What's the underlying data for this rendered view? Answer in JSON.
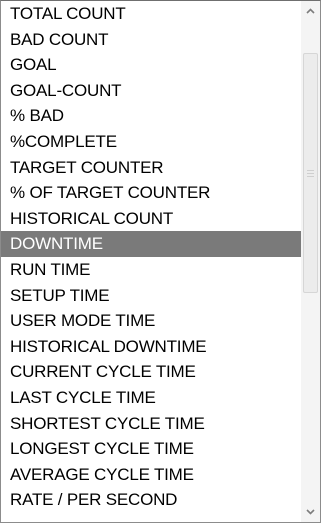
{
  "list": {
    "items": [
      {
        "label": "TOTAL COUNT",
        "selected": false
      },
      {
        "label": "BAD COUNT",
        "selected": false
      },
      {
        "label": "GOAL",
        "selected": false
      },
      {
        "label": "GOAL-COUNT",
        "selected": false
      },
      {
        "label": "% BAD",
        "selected": false
      },
      {
        "label": "%COMPLETE",
        "selected": false
      },
      {
        "label": "TARGET COUNTER",
        "selected": false
      },
      {
        "label": "% OF TARGET COUNTER",
        "selected": false
      },
      {
        "label": "HISTORICAL COUNT",
        "selected": false
      },
      {
        "label": "DOWNTIME",
        "selected": true
      },
      {
        "label": "RUN TIME",
        "selected": false
      },
      {
        "label": "SETUP TIME",
        "selected": false
      },
      {
        "label": "USER MODE TIME",
        "selected": false
      },
      {
        "label": "HISTORICAL DOWNTIME",
        "selected": false
      },
      {
        "label": "CURRENT CYCLE TIME",
        "selected": false
      },
      {
        "label": "LAST CYCLE TIME",
        "selected": false
      },
      {
        "label": "SHORTEST CYCLE TIME",
        "selected": false
      },
      {
        "label": "LONGEST CYCLE TIME",
        "selected": false
      },
      {
        "label": "AVERAGE CYCLE TIME",
        "selected": false
      },
      {
        "label": "RATE / PER SECOND",
        "selected": false
      }
    ],
    "selected_color": "#7a7a7a"
  },
  "scrollbar": {
    "up_icon": "chevron-up-icon",
    "down_icon": "chevron-down-icon",
    "scroll_position": 0
  }
}
